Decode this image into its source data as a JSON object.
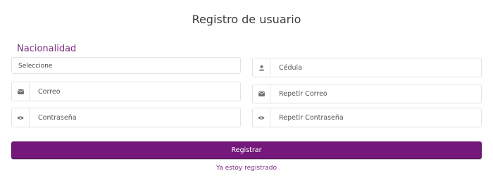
{
  "form": {
    "title": "Registro de usuario",
    "nationality": {
      "label": "Nacionalidad",
      "selected": "Seleccione"
    },
    "fields": {
      "cedula": {
        "placeholder": "Cédula",
        "icon": "user-icon"
      },
      "correo": {
        "placeholder": "Correo",
        "icon": "envelope-icon"
      },
      "repetir_correo": {
        "placeholder": "Repetir Correo",
        "icon": "envelope-icon"
      },
      "contrasena": {
        "placeholder": "Contraseña",
        "icon": "eye-icon"
      },
      "repetir_contrasena": {
        "placeholder": "Repetir Contraseña",
        "icon": "eye-icon"
      }
    },
    "submit_label": "Registrar",
    "login_link": "Ya estoy registrado"
  },
  "colors": {
    "accent": "#74197b",
    "label": "#7b2d83",
    "icon": "#6e6e6e"
  }
}
